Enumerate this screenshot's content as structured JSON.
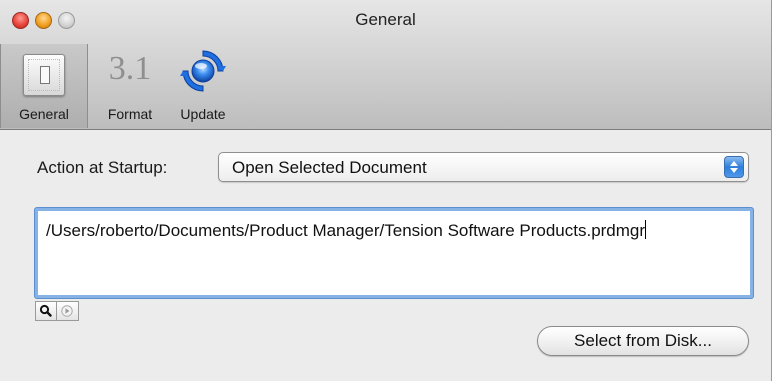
{
  "window": {
    "title": "General"
  },
  "toolbar": {
    "items": [
      {
        "label": "General",
        "icon": "switch-icon",
        "selected": true
      },
      {
        "label": "Format",
        "glyph": "3.1",
        "icon": "format-icon"
      },
      {
        "label": "Update",
        "icon": "update-icon"
      }
    ]
  },
  "general": {
    "startup_label": "Action at Startup:",
    "startup_value": "Open Selected Document",
    "path_value": "/Users/roberto/Documents/Product Manager/Tension Software Products.prdmgr",
    "select_button_label": "Select from Disk..."
  },
  "colors": {
    "close": "#e8463c",
    "minimize": "#f2a024",
    "zoom": "#d2d2d2",
    "focus_ring": "#87b2e6",
    "stepper_blue": "#2f7fdc",
    "update_blue": "#1f6fe0"
  }
}
